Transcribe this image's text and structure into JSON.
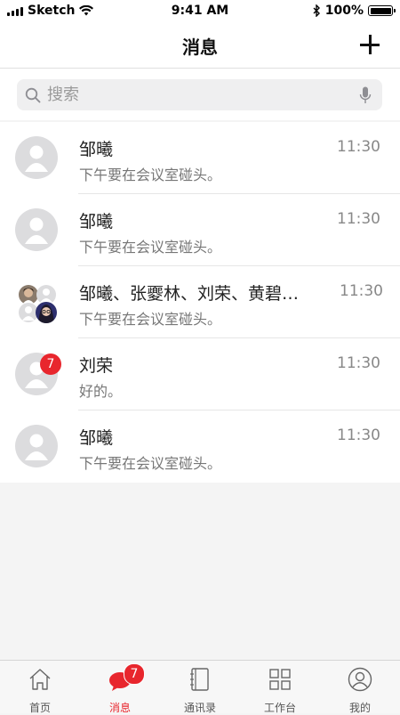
{
  "status_bar": {
    "carrier": "Sketch",
    "time": "9:41 AM",
    "battery": "100%",
    "battery_level": 1.0
  },
  "nav": {
    "title": "消息",
    "add_icon": "plus-icon"
  },
  "search": {
    "placeholder": "搜索",
    "icon": "search-icon",
    "voice_icon": "mic-icon"
  },
  "conversations": [
    {
      "name": "邹曦",
      "message": "下午要在会议室碰头。",
      "time": "11:30",
      "avatar": "person-avatar"
    },
    {
      "name": "邹曦",
      "message": "下午要在会议室碰头。",
      "time": "11:30",
      "avatar": "person-avatar"
    },
    {
      "name": "邹曦、张夒林、刘荣、黄碧…",
      "message": "下午要在会议室碰头。",
      "time": "11:30",
      "avatar": "group-avatar"
    },
    {
      "name": "刘荣",
      "message": "好的。",
      "time": "11:30",
      "avatar": "person-avatar",
      "unread": "7"
    },
    {
      "name": "邹曦",
      "message": "下午要在会议室碰头。",
      "time": "11:30",
      "avatar": "person-avatar"
    }
  ],
  "tabs": [
    {
      "label": "首页",
      "icon": "home-icon"
    },
    {
      "label": "消息",
      "icon": "chat-bubble-icon",
      "badge": "7",
      "active": true
    },
    {
      "label": "通讯录",
      "icon": "contacts-book-icon"
    },
    {
      "label": "工作台",
      "icon": "grid-apps-icon"
    },
    {
      "label": "我的",
      "icon": "profile-icon"
    }
  ],
  "colors": {
    "accent": "#e8262d",
    "background": "#f4f4f4"
  }
}
